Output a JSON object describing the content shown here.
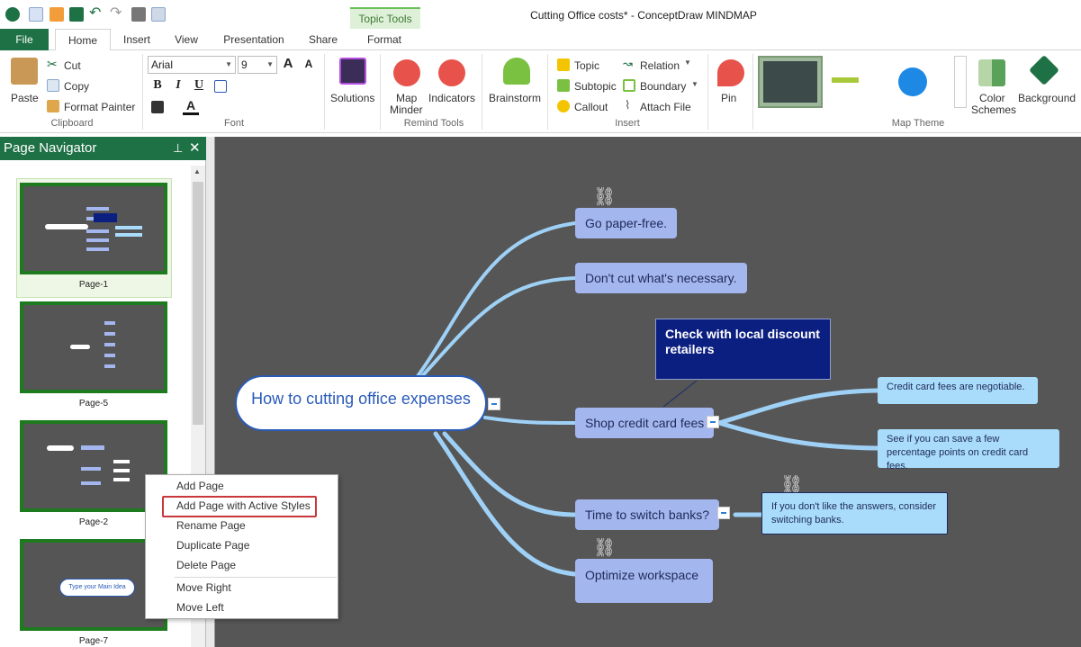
{
  "window": {
    "title": "Cutting Office costs* - ConceptDraw MINDMAP",
    "contextual_tab": "Topic Tools"
  },
  "tabs": [
    "File",
    "Home",
    "Insert",
    "View",
    "Presentation",
    "Share",
    "Format"
  ],
  "ribbon": {
    "clipboard": {
      "paste": "Paste",
      "cut": "Cut",
      "copy": "Copy",
      "format_painter": "Format Painter",
      "label": "Clipboard"
    },
    "font": {
      "family": "Arial",
      "size": "9",
      "label": "Font"
    },
    "solutions": {
      "label": "Solutions"
    },
    "remind_tools": {
      "map_minder_1": "Map",
      "map_minder_2": "Minder",
      "indicators": "Indicators",
      "label": "Remind Tools"
    },
    "brainstorm": "Brainstorm",
    "insert": {
      "topic": "Topic",
      "subtopic": "Subtopic",
      "callout": "Callout",
      "relation": "Relation",
      "boundary": "Boundary",
      "attach_file": "Attach File",
      "label": "Insert"
    },
    "pin": "Pin",
    "map_theme": {
      "label": "Map Theme"
    },
    "color_schemes_1": "Color",
    "color_schemes_2": "Schemes",
    "background": "Background"
  },
  "navigator": {
    "title": "Page Navigator",
    "pages": [
      "Page-1",
      "Page-5",
      "Page-2",
      "Page-7"
    ],
    "page7_main_idea": "Type your Main Idea"
  },
  "context_menu": {
    "items": [
      "Add Page",
      "Add Page with Active Styles",
      "Rename Page",
      "Duplicate Page",
      "Delete Page",
      "Move Right",
      "Move Left"
    ],
    "highlighted": "Add Page with Active Styles"
  },
  "mindmap": {
    "main_idea": "How to cutting office expenses",
    "topics": [
      "Go paper-free.",
      "Don't cut what's necessary.",
      "Shop credit card fees",
      "Time to switch banks?",
      "Optimize workspace"
    ],
    "callout": "Check with local discount retailers",
    "credit_subtopics": [
      "Credit card fees are negotiable.",
      "See if you can save a few percentage points on credit card fees."
    ],
    "banks_note": "If you don't like the answers, consider switching banks."
  },
  "colors": {
    "brand_green": "#1e7145",
    "canvas_bg": "#565656",
    "topic_fill": "#a4b6ee",
    "subtopic_fill": "#a9dcfa",
    "callout_fill": "#0b1f80",
    "branch": "#9fd1f7",
    "highlight_border": "#c9373a"
  }
}
